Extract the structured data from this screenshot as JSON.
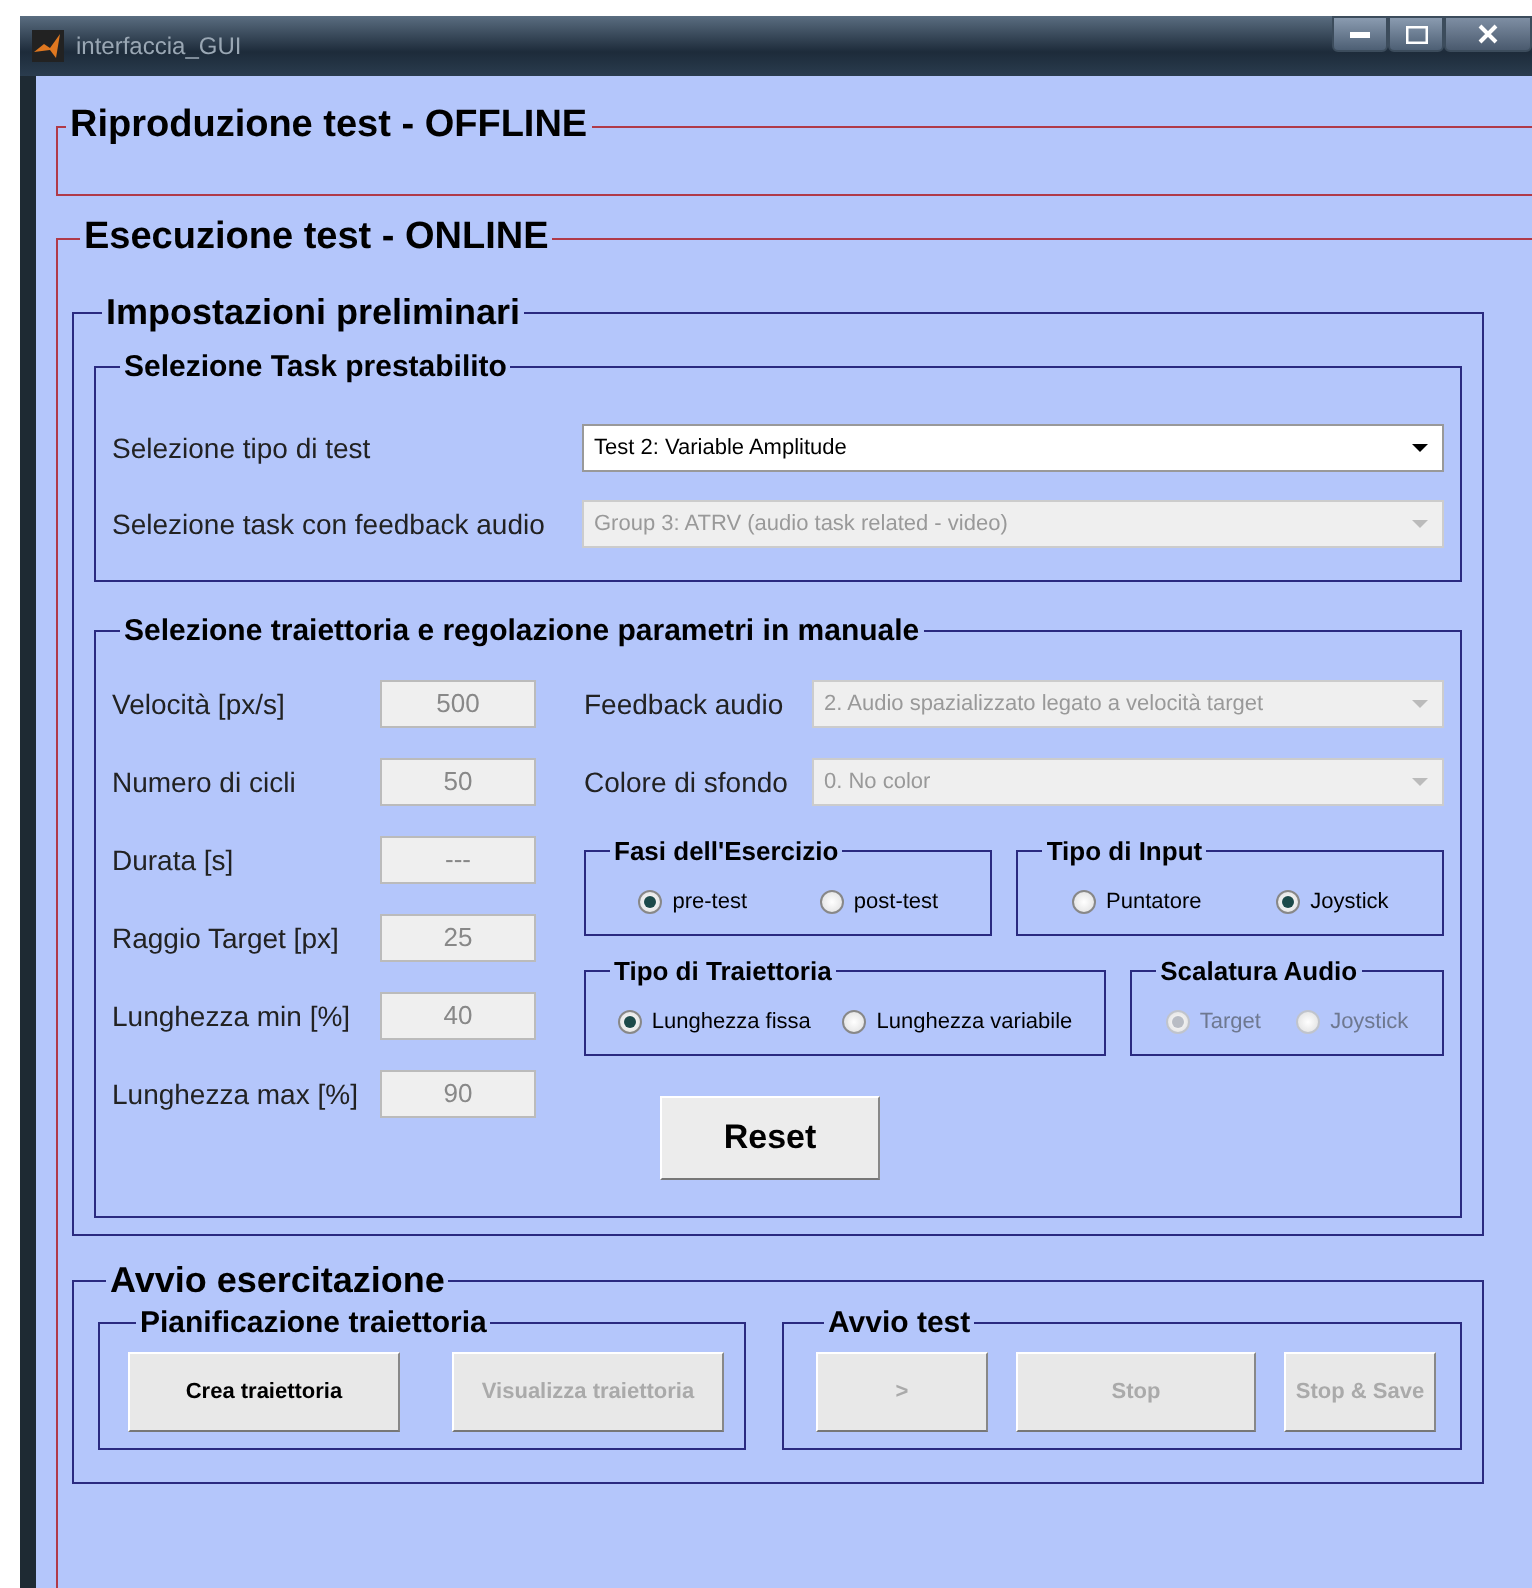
{
  "window": {
    "title": "interfaccia_GUI"
  },
  "offline_panel": {
    "title": "Riproduzione test  -  OFFLINE"
  },
  "online_panel": {
    "title": "Esecuzione test  -  ONLINE",
    "settings": {
      "title": "Impostazioni preliminari",
      "task_group": {
        "title": "Selezione Task prestabilito",
        "rows": [
          {
            "label": "Selezione tipo di test",
            "value": "Test 2: Variable Amplitude",
            "disabled": false
          },
          {
            "label": "Selezione task con feedback audio",
            "value": "Group 3: ATRV (audio task related - video)",
            "disabled": true
          }
        ]
      },
      "manual_group": {
        "title": "Selezione traiettoria e regolazione parametri in manuale",
        "params": [
          {
            "label": "Velocità [px/s]",
            "value": "500",
            "disabled": true
          },
          {
            "label": "Numero di cicli",
            "value": "50",
            "disabled": true
          },
          {
            "label": "Durata [s]",
            "value": "---",
            "disabled": true
          },
          {
            "label": "Raggio Target [px]",
            "value": "25",
            "disabled": true
          },
          {
            "label": "Lunghezza min [%]",
            "value": "40",
            "disabled": true
          },
          {
            "label": "Lunghezza max [%]",
            "value": "90",
            "disabled": true
          }
        ],
        "dropdowns": [
          {
            "label": "Feedback audio",
            "value": "2. Audio spazializzato legato a velocità target",
            "disabled": true
          },
          {
            "label": "Colore di sfondo",
            "value": "0. No color",
            "disabled": true
          }
        ],
        "radio_rows": [
          [
            {
              "title": "Fasi dell'Esercizio",
              "disabled": false,
              "options": [
                {
                  "label": "pre-test",
                  "selected": true
                },
                {
                  "label": "post-test",
                  "selected": false
                }
              ]
            },
            {
              "title": "Tipo di Input",
              "disabled": false,
              "options": [
                {
                  "label": "Puntatore",
                  "selected": false
                },
                {
                  "label": "Joystick",
                  "selected": true
                }
              ]
            }
          ],
          [
            {
              "title": "Tipo di Traiettoria",
              "disabled": false,
              "options": [
                {
                  "label": "Lunghezza fissa",
                  "selected": true
                },
                {
                  "label": "Lunghezza variabile",
                  "selected": false
                }
              ]
            },
            {
              "title": "Scalatura Audio",
              "disabled": true,
              "options": [
                {
                  "label": "Target",
                  "selected": true
                },
                {
                  "label": "Joystick",
                  "selected": false
                }
              ]
            }
          ]
        ],
        "reset_button": "Reset"
      }
    },
    "start": {
      "title": "Avvio esercitazione",
      "groups": [
        {
          "title": "Pianificazione traiettoria",
          "buttons": [
            {
              "label": "Crea traiettoria",
              "disabled": false
            },
            {
              "label": "Visualizza traiettoria",
              "disabled": true
            }
          ]
        },
        {
          "title": "Avvio test",
          "buttons": [
            {
              "label": ">",
              "disabled": true
            },
            {
              "label": "Stop",
              "disabled": true
            },
            {
              "label": "Stop & Save",
              "disabled": true
            }
          ]
        }
      ]
    }
  }
}
